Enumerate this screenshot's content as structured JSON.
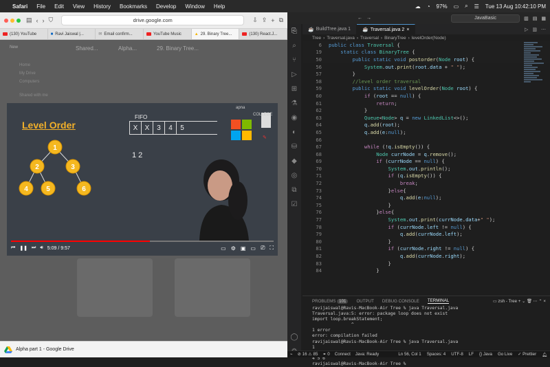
{
  "menubar": {
    "app": "Safari",
    "items": [
      "File",
      "Edit",
      "View",
      "History",
      "Bookmarks",
      "Develop",
      "Window",
      "Help"
    ],
    "battery": "97%",
    "datetime": "Tue 13 Aug  10:42:10 PM"
  },
  "safari": {
    "url": "drive.google.com",
    "tabs": [
      {
        "label": "(130) YouTube"
      },
      {
        "label": "Ravi Jaiswal |..."
      },
      {
        "label": "Email confirm..."
      },
      {
        "label": "YouTube Music"
      },
      {
        "label": "29. Binary Tree..."
      },
      {
        "label": "(130) React.J..."
      }
    ],
    "footer": "Alpha part 1 - Google Drive",
    "bg": {
      "new": "New",
      "crumb1": "Shared...",
      "crumb2": "Alpha...",
      "crumb3": "29. Binary Tree...",
      "side1": "Home",
      "side2": "My Drive",
      "side3": "Computers",
      "side4": "Shared with me"
    }
  },
  "video": {
    "title": "Level Order",
    "fifo_label": "FIFO",
    "queue_cells": [
      "X",
      "X",
      "3",
      "4",
      "5"
    ],
    "output": "1  2",
    "time": "5:09 / 9:57",
    "progress": 0.53,
    "tree_nodes": [
      "1",
      "2",
      "3",
      "4",
      "5",
      "6"
    ],
    "college_label": "COLLEGE",
    "logo_top": "apna"
  },
  "vscode": {
    "search": "JavaBasic",
    "tabs": [
      {
        "label": "BuildTree.java 1"
      },
      {
        "label": "Traversal.java 2"
      }
    ],
    "breadcrumb": [
      "Tree",
      "Traversal.java",
      "Traversal",
      "BinaryTree",
      "levelOrder(Node)"
    ],
    "panel_tabs": [
      "PROBLEMS",
      "101",
      "OUTPUT",
      "DEBUG CONSOLE",
      "TERMINAL"
    ],
    "terminal_label": "zsh - Tree",
    "terminal_lines": [
      "ravijaiswal@Ravis-MacBook-Air Tree % java Traversal.java",
      "Traversal.java:5: error: package loop does not exist",
      "import loop.breakStatement;",
      "               ^",
      "1 error",
      "error: compilation failed",
      "ravijaiswal@Ravis-MacBook-Air Tree % java Traversal.java",
      "1",
      "2 3",
      "4 5 6",
      "ravijaiswal@Ravis-MacBook-Air Tree % "
    ],
    "status_left": [
      "⊘ 16 ⚠ 85",
      "⚭ 0",
      "Connect",
      "Java: Ready"
    ],
    "status_right": [
      "Ln 56, Col 1",
      "Spaces: 4",
      "UTF-8",
      "LF",
      "{} Java",
      "Go Live",
      "✓ Prettier"
    ]
  }
}
